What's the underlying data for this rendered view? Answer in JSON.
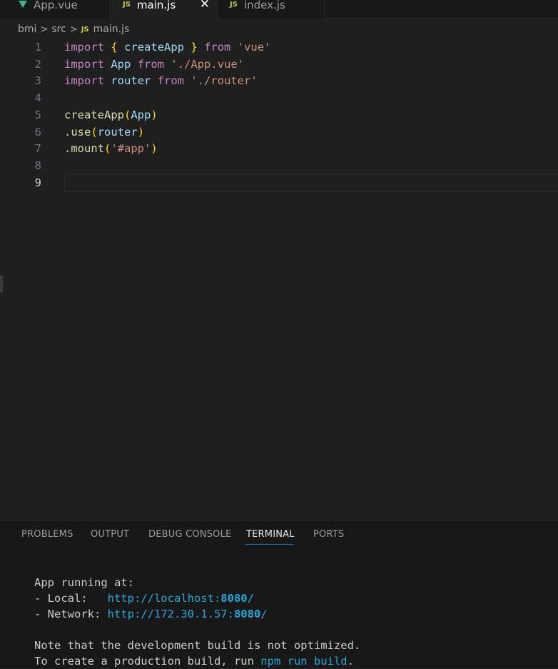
{
  "tabs": [
    {
      "label": "App.vue",
      "icon": "vue-icon",
      "active": false
    },
    {
      "label": "main.js",
      "icon": "js-icon",
      "active": true
    },
    {
      "label": "index.js",
      "icon": "js-icon",
      "active": false
    }
  ],
  "js_badge": "JS",
  "close_glyph": "✕",
  "breadcrumb": [
    "bmi",
    "src",
    "main.js"
  ],
  "breadcrumb_sep": ">",
  "editor": {
    "current_line": 9,
    "lines": [
      {
        "num": "1",
        "tokens": [
          [
            "kw",
            "import"
          ],
          [
            "",
            "  "
          ],
          [
            "br1",
            "{"
          ],
          [
            "",
            "  "
          ],
          [
            "var",
            "createApp"
          ],
          [
            "",
            "  "
          ],
          [
            "br1",
            "}"
          ],
          [
            "",
            "  "
          ],
          [
            "kw",
            "from"
          ],
          [
            "",
            "  "
          ],
          [
            "str",
            "'vue'"
          ]
        ]
      },
      {
        "num": "2",
        "tokens": [
          [
            "kw",
            "import"
          ],
          [
            "",
            "  "
          ],
          [
            "var",
            "App"
          ],
          [
            "",
            "  "
          ],
          [
            "kw",
            "from"
          ],
          [
            "",
            "  "
          ],
          [
            "str",
            "'./App.vue'"
          ]
        ]
      },
      {
        "num": "3",
        "tokens": [
          [
            "kw",
            "import"
          ],
          [
            "",
            "  "
          ],
          [
            "var",
            "router"
          ],
          [
            "",
            "  "
          ],
          [
            "kw",
            "from"
          ],
          [
            "",
            "  "
          ],
          [
            "str",
            "'./router'"
          ]
        ]
      },
      {
        "num": "4",
        "tokens": []
      },
      {
        "num": "5",
        "tokens": [
          [
            "fn",
            "createApp"
          ],
          [
            "br1",
            "("
          ],
          [
            "var",
            "App"
          ],
          [
            "br1",
            ")"
          ]
        ]
      },
      {
        "num": "6",
        "tokens": [
          [
            "",
            "."
          ],
          [
            "fn",
            "use"
          ],
          [
            "br1",
            "("
          ],
          [
            "var",
            "router"
          ],
          [
            "br1",
            ")"
          ]
        ]
      },
      {
        "num": "7",
        "tokens": [
          [
            "",
            "."
          ],
          [
            "fn",
            "mount"
          ],
          [
            "br1",
            "("
          ],
          [
            "str",
            "'#app'"
          ],
          [
            "br1",
            ")"
          ]
        ]
      },
      {
        "num": "8",
        "tokens": []
      },
      {
        "num": "9",
        "tokens": []
      }
    ]
  },
  "panel": {
    "tabs": [
      "PROBLEMS",
      "OUTPUT",
      "DEBUG CONSOLE",
      "TERMINAL",
      "PORTS"
    ],
    "active_tab": "TERMINAL"
  },
  "terminal": {
    "running": "App running at:",
    "local_label": "- Local:   ",
    "local_url_pre": "http://localhost:",
    "local_port": "8080",
    "local_url_post": "/",
    "network_label": "- Network: ",
    "network_url_pre": "http://172.30.1.57:",
    "network_port": "8080",
    "network_url_post": "/",
    "note": "Note that the development build is not optimized.",
    "build_pre": "To create a production build, run ",
    "build_cmd": "npm run build",
    "build_post": "."
  },
  "colors": {
    "background": "#1f1f1f",
    "keyword": "#c586c0",
    "function": "#dcdcaa",
    "variable": "#9cdcfe",
    "string": "#ce9178",
    "bracket": "#ffd700",
    "link": "#23a8d8",
    "accent": "#0078d4"
  }
}
